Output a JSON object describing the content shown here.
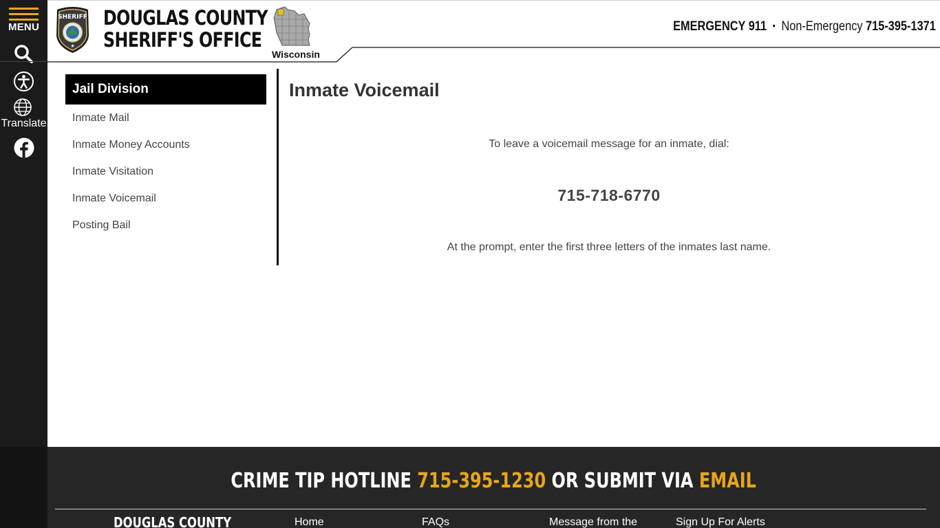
{
  "rail": {
    "menu_label": "MENU",
    "translate_label": "Translate",
    "accent_color": "#e8a619",
    "icons": [
      "hamburger-icon",
      "search-icon",
      "accessibility-icon",
      "globe-icon",
      "facebook-icon"
    ]
  },
  "header": {
    "title_line1": "DOUGLAS COUNTY",
    "title_line2": "SHERIFF'S OFFICE",
    "badge_text": "SHERIFF",
    "state_label": "Wisconsin",
    "emergency_label": "EMERGENCY 911",
    "separator": "•",
    "non_emergency_label": "Non-Emergency",
    "non_emergency_number": "715-395-1371"
  },
  "sidebar": {
    "heading": "Jail Division",
    "items": [
      {
        "label": "Inmate Mail"
      },
      {
        "label": "Inmate Money Accounts"
      },
      {
        "label": "Inmate Visitation"
      },
      {
        "label": "Inmate Voicemail"
      },
      {
        "label": "Posting Bail"
      }
    ]
  },
  "main": {
    "title": "Inmate Voicemail",
    "intro": "To leave a voicemail message for an inmate, dial:",
    "phone": "715-718-6770",
    "instructions": "At the prompt, enter the first three letters of the inmates last name."
  },
  "footer": {
    "tip_prefix": "CRIME TIP HOTLINE",
    "tip_number": "715-395-1230",
    "tip_middle": "OR SUBMIT VIA",
    "tip_email": "EMAIL",
    "brand": "DOUGLAS COUNTY",
    "links": [
      {
        "label": "Home"
      },
      {
        "label": "FAQs"
      },
      {
        "label": "Message from the"
      },
      {
        "label": "Sign Up For Alerts"
      }
    ]
  }
}
